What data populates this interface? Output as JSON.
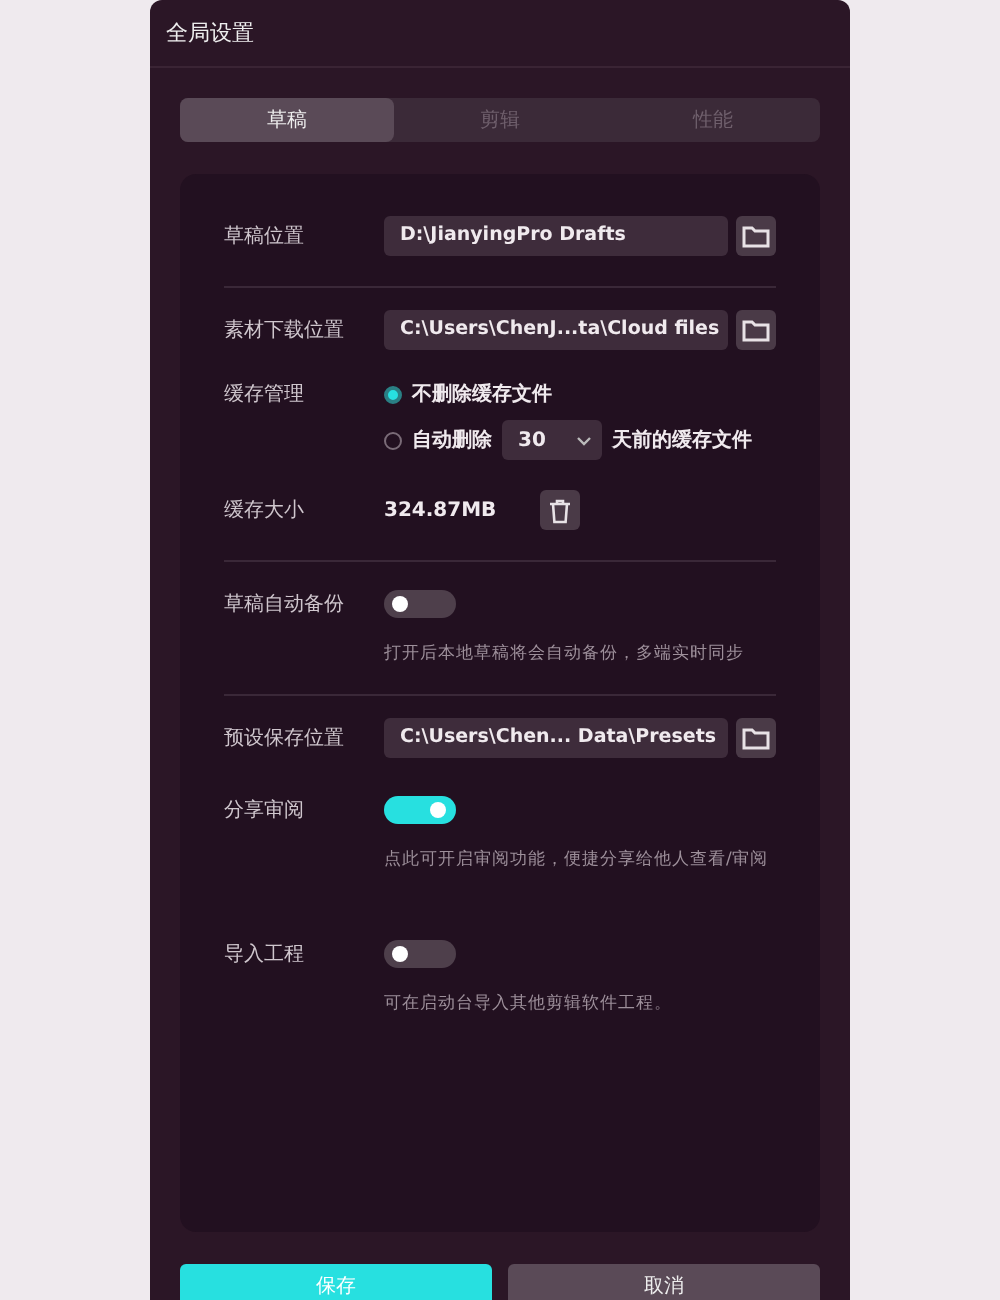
{
  "window": {
    "title": "全局设置"
  },
  "tabs": [
    {
      "label": "草稿",
      "selected": true
    },
    {
      "label": "剪辑",
      "selected": false
    },
    {
      "label": "性能",
      "selected": false
    }
  ],
  "sections": [
    [
      {
        "kind": "path",
        "label": "草稿位置",
        "value": "D:\\JianyingPro Drafts"
      }
    ],
    [
      {
        "kind": "path",
        "label": "素材下载位置",
        "value": "C:\\Users\\ChenJ...ta\\Cloud files"
      },
      {
        "kind": "radio",
        "label": "缓存管理",
        "options": [
          {
            "text": "不删除缓存文件",
            "selected": true
          },
          {
            "text": "自动删除",
            "selected": false,
            "dropdown": "30",
            "suffix": "天前的缓存文件"
          }
        ]
      },
      {
        "kind": "size",
        "label": "缓存大小",
        "value": "324.87MB"
      }
    ],
    [
      {
        "kind": "toggle",
        "label": "草稿自动备份",
        "on": false,
        "description": "打开后本地草稿将会自动备份，多端实时同步"
      }
    ],
    [
      {
        "kind": "path",
        "label": "预设保存位置",
        "value": "C:\\Users\\Chen... Data\\Presets"
      },
      {
        "kind": "toggle",
        "label": "分享审阅",
        "on": true,
        "description": "点此可开启审阅功能，便捷分享给他人查看/审阅"
      },
      {
        "kind": "toggle",
        "label": "导入工程",
        "on": false,
        "description": "可在启动台导入其他剪辑软件工程。"
      }
    ]
  ],
  "buttons": [
    {
      "label": "保存",
      "kind": "primary"
    },
    {
      "label": "取消",
      "kind": "secondary"
    }
  ]
}
